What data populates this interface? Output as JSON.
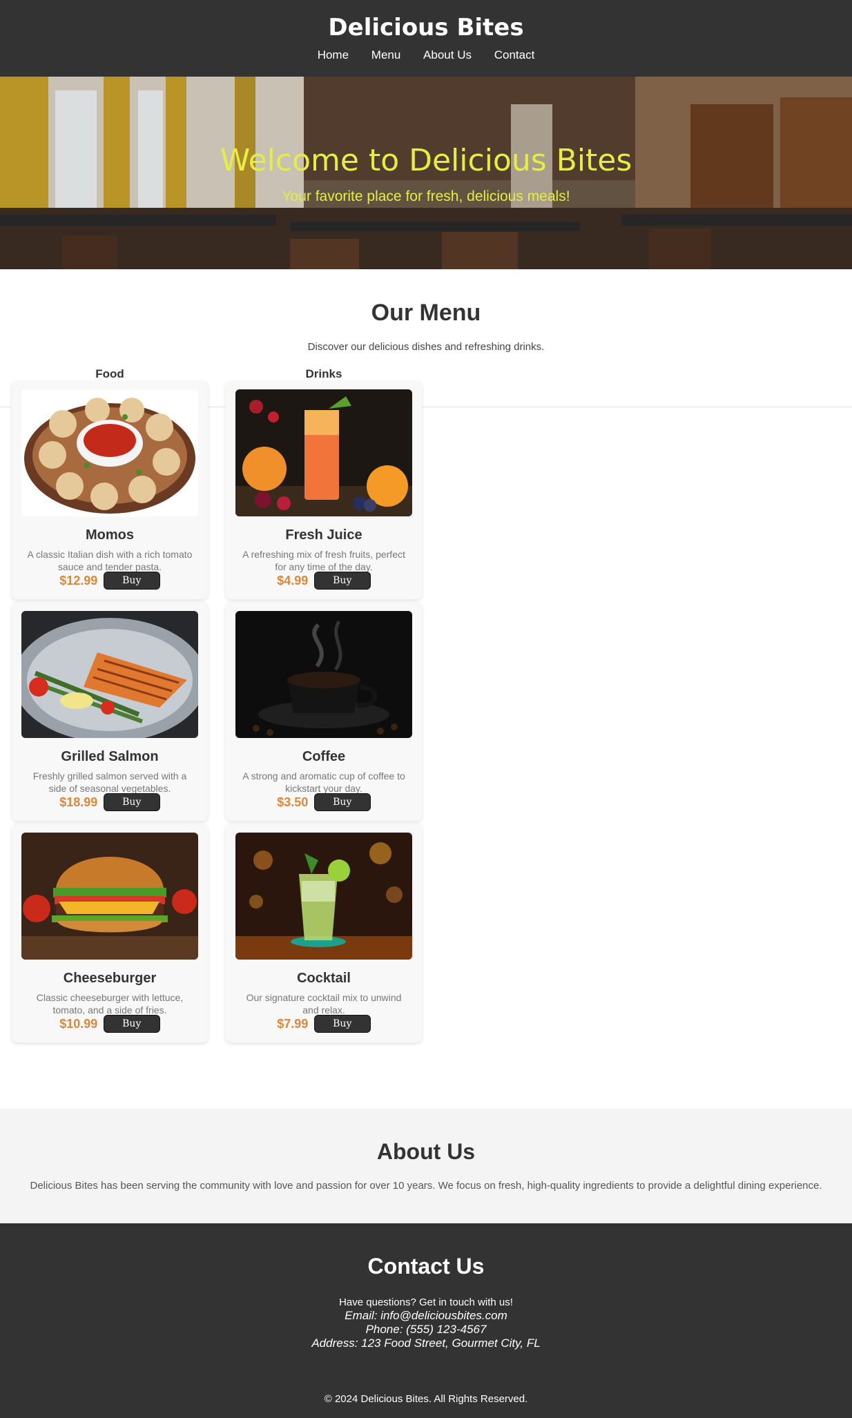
{
  "header": {
    "title": "Delicious Bites",
    "nav": [
      "Home",
      "Menu",
      "About Us",
      "Contact"
    ]
  },
  "hero": {
    "title": "Welcome to Delicious Bites",
    "subtitle": "Your favorite place for fresh, delicious meals!",
    "text_color": "#e6ed45"
  },
  "menu": {
    "title": "Our Menu",
    "subtitle": "Discover our delicious dishes and refreshing drinks.",
    "food_heading": "Food",
    "drinks_heading": "Drinks",
    "buy_label": "Buy",
    "price_color": "#d9883a",
    "food": [
      {
        "name": "Momos",
        "description": "A classic Italian dish with a rich tomato sauce and tender pasta.",
        "price": "$12.99"
      },
      {
        "name": "Grilled Salmon",
        "description": "Freshly grilled salmon served with a side of seasonal vegetables.",
        "price": "$18.99"
      },
      {
        "name": "Cheeseburger",
        "description": "Classic cheeseburger with lettuce, tomato, and a side of fries.",
        "price": "$10.99"
      }
    ],
    "drinks": [
      {
        "name": "Fresh Juice",
        "description": "A refreshing mix of fresh fruits, perfect for any time of the day.",
        "price": "$4.99"
      },
      {
        "name": "Coffee",
        "description": "A strong and aromatic cup of coffee to kickstart your day.",
        "price": "$3.50"
      },
      {
        "name": "Cocktail",
        "description": "Our signature cocktail mix to unwind and relax.",
        "price": "$7.99"
      }
    ]
  },
  "about": {
    "title": "About Us",
    "text": "Delicious Bites has been serving the community with love and passion for over 10 years. We focus on fresh, high-quality ingredients to provide a delightful dining experience."
  },
  "contact": {
    "title": "Contact Us",
    "intro": "Have questions? Get in touch with us!",
    "email": "Email: info@deliciousbites.com",
    "phone": "Phone: (555) 123-4567",
    "address": "Address: 123 Food Street, Gourmet City, FL",
    "copyright": "© 2024 Delicious Bites. All Rights Reserved."
  },
  "colors": {
    "header_bg": "#333333",
    "about_bg": "#f4f4f4"
  }
}
